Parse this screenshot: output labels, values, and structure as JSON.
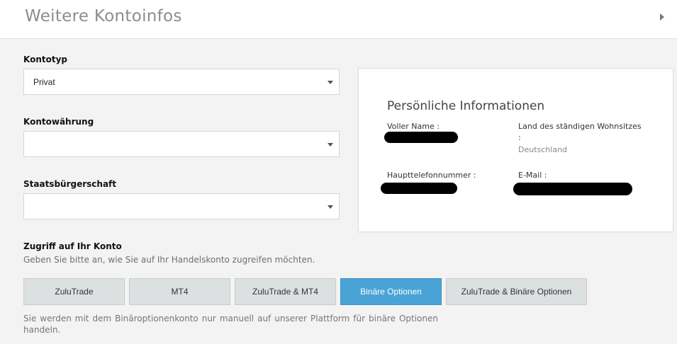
{
  "header": {
    "title": "Weitere Kontoinfos",
    "expand_icon": "triangle-right-icon"
  },
  "form": {
    "account_type": {
      "label": "Kontotyp",
      "value": "Privat"
    },
    "currency": {
      "label": "Kontowährung",
      "value": ""
    },
    "citizenship": {
      "label": "Staatsbürgerschaft",
      "value": ""
    }
  },
  "info": {
    "title": "Persönliche Informationen",
    "full_name_label": "Voller Name :",
    "country_label": "Land des ständigen Wohnsitzes",
    "country_colon": ":",
    "country_value": "Deutschland",
    "phone_label": "Haupttelefonnummer :",
    "email_label": "E-Mail :"
  },
  "access": {
    "title": "Zugriff auf Ihr Konto",
    "subtitle": "Geben Sie bitte an, wie Sie auf Ihr Handelskonto zugreifen möchten.",
    "options": [
      {
        "label": "ZuluTrade",
        "selected": false
      },
      {
        "label": "MT4",
        "selected": false
      },
      {
        "label": "ZuluTrade & MT4",
        "selected": false
      },
      {
        "label": "Binäre Optionen",
        "selected": true
      },
      {
        "label": "ZuluTrade & Binäre Optionen",
        "selected": false
      }
    ],
    "note": "Sie werden mit dem Binäroptionenkonto nur manuell auf unserer Plattform für binäre Optionen handeln."
  },
  "colors": {
    "accent": "#4aa3d6",
    "button_bg": "#dde0e1",
    "page_bg": "#f3f3f3"
  }
}
